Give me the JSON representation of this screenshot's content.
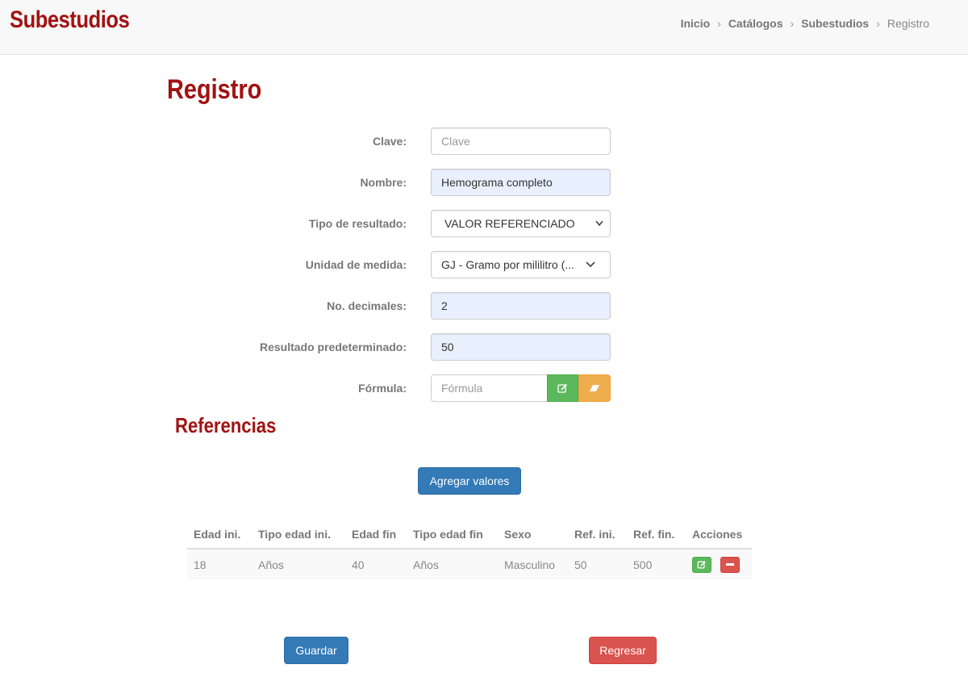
{
  "header": {
    "brand": "Subestudios",
    "breadcrumb": [
      "Inicio",
      "Catálogos",
      "Subestudios",
      "Registro"
    ]
  },
  "page_title": "Registro",
  "form": {
    "clave": {
      "label": "Clave:",
      "value": "",
      "placeholder": "Clave"
    },
    "nombre": {
      "label": "Nombre:",
      "value": "Hemograma completo"
    },
    "tipo_resultado": {
      "label": "Tipo de resultado:",
      "selected": "VALOR REFERENCIADO"
    },
    "unidad_medida": {
      "label": "Unidad de medida:",
      "selected": "GJ - Gramo por mililitro (..."
    },
    "decimales": {
      "label": "No. decimales:",
      "value": "2"
    },
    "resultado_predeterminado": {
      "label": "Resultado predeterminado:",
      "value": "50"
    },
    "formula": {
      "label": "Fórmula:",
      "value": "",
      "placeholder": "Fórmula"
    }
  },
  "referencias": {
    "title": "Referencias",
    "add_button": "Agregar valores",
    "columns": [
      "Edad ini.",
      "Tipo edad ini.",
      "Edad fin",
      "Tipo edad fin",
      "Sexo",
      "Ref. ini.",
      "Ref. fin.",
      "Acciones"
    ],
    "rows": [
      [
        "18",
        "Años",
        "40",
        "Años",
        "Masculino",
        "50",
        "500"
      ]
    ]
  },
  "actions": {
    "save": "Guardar",
    "back": "Regresar"
  },
  "colors": {
    "brand": "#a11212",
    "primary": "#337ab7",
    "success": "#5cb85c",
    "warning": "#f0ad4e",
    "danger": "#d9534f"
  },
  "icons": {
    "edit": "edit-icon",
    "eraser": "eraser-icon",
    "remove": "minus-icon",
    "chevron": "chevron-down-icon"
  }
}
